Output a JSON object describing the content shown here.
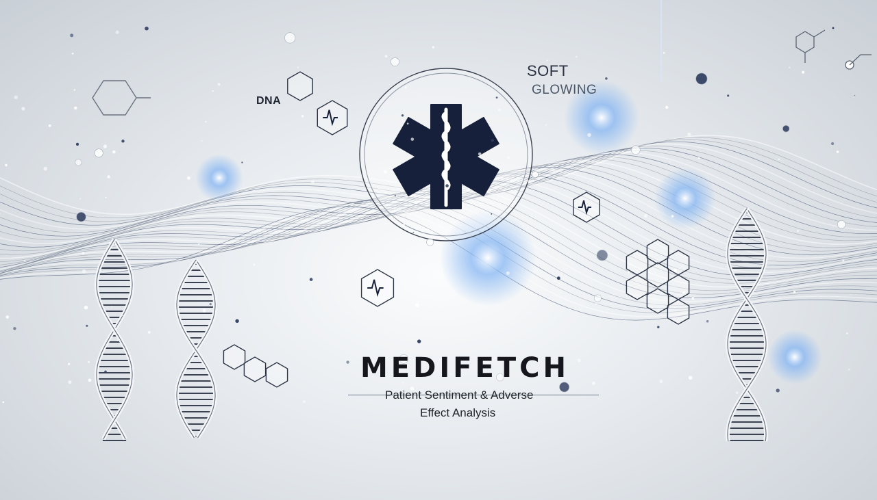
{
  "brand": {
    "title": "MEDIFETCH",
    "tagline_line1": "Patient Sentiment & Adverse",
    "tagline_line2": "Effect Analysis"
  },
  "labels": {
    "dna": "DNA",
    "soft": "SOFT",
    "glowing": "GLOWING"
  },
  "icons": [
    "star-of-life-icon",
    "rod-of-asclepius-icon",
    "dna-helix-icon",
    "heartbeat-icon",
    "hexagon-icon",
    "molecule-icon"
  ],
  "colors": {
    "background": "#e6eaee",
    "emblem": "#17203a",
    "accent_glow": "#4f8fe6",
    "text": "#15171c"
  }
}
